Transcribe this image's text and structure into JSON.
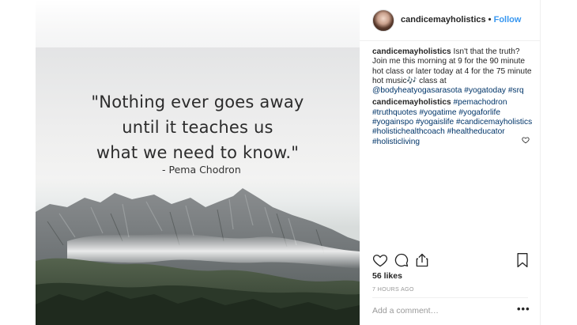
{
  "post": {
    "quote_lines": [
      "\"Nothing ever goes away",
      "until it teaches us",
      "what we need to know.\""
    ],
    "attribution": "- Pema Chodron"
  },
  "header": {
    "username": "candicemayholistics",
    "separator": "•",
    "follow_label": "Follow"
  },
  "caption": {
    "username": "candicemayholistics",
    "text": " Isn't that the truth? Join me this morning at 9 for the 90 minute hot class or later today at 4 for the 75 minute hot music🎶 class at ",
    "mention": "@bodyheatyogasarasota",
    "tags": [
      "#yogatoday",
      "#srq"
    ]
  },
  "comment": {
    "username": "candicemayholistics",
    "tags": [
      "#pemachodron",
      "#truthquotes",
      "#yogatime",
      "#yogaforlife",
      "#yogainspo",
      "#yogaislife",
      "#candicemayholistics",
      "#holistichealthcoach",
      "#healtheducator",
      "#holisticliving"
    ]
  },
  "stats": {
    "likes": "56 likes",
    "time": "7 HOURS AGO"
  },
  "composer": {
    "placeholder": "Add a comment…",
    "more_label": "•••"
  },
  "icons": {
    "heart": "heart-icon",
    "comment": "comment-icon",
    "share": "share-icon",
    "save": "bookmark-icon"
  }
}
